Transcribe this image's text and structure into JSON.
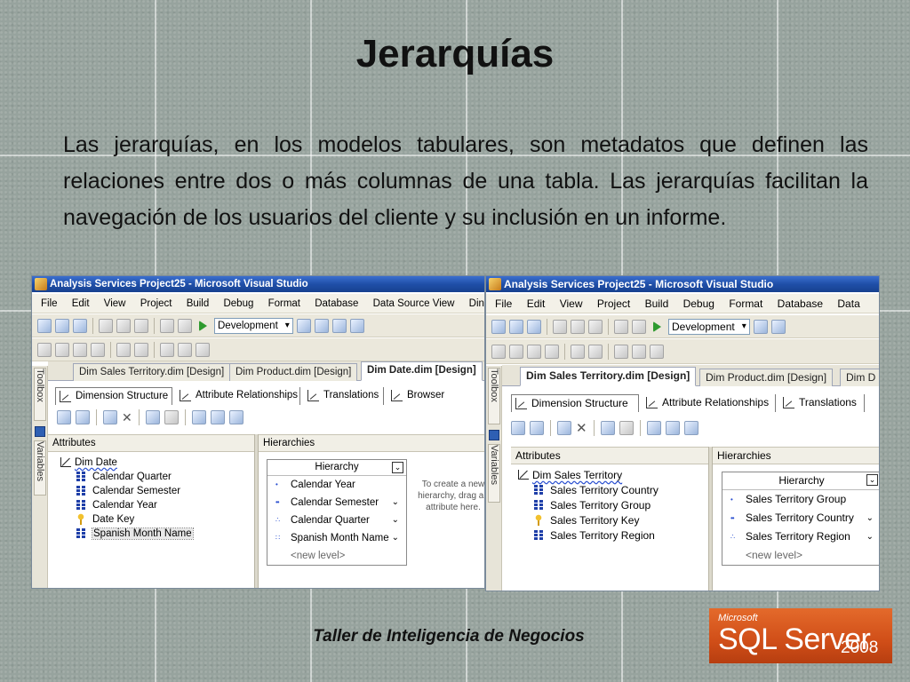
{
  "slide": {
    "title": "Jerarquías",
    "body": "Las jerarquías, en los modelos tabulares, son metadatos que definen las relaciones entre dos o más columnas de una tabla. Las jerarquías facilitan la navegación de los usuarios del cliente y su inclusión en un informe.",
    "footer": "Taller de Inteligencia de Negocios"
  },
  "logo": {
    "small": "Microsoft",
    "main": "SQL Server",
    "year": "2008"
  },
  "colors": {
    "logo_orange": "#d9561f",
    "titlebar_blue": "#1f4fa8",
    "background_gray": "#97a39e"
  },
  "screenshots": [
    {
      "window_title": "Analysis Services Project25 - Microsoft Visual Studio",
      "menu": [
        "File",
        "Edit",
        "View",
        "Project",
        "Build",
        "Debug",
        "Format",
        "Database",
        "Data Source View",
        "Din"
      ],
      "config": "Development",
      "side_labels": [
        "Toolbox",
        "Variables"
      ],
      "doc_tabs": [
        "Dim Sales Territory.dim [Design]",
        "Dim Product.dim [Design]",
        "Dim Date.dim [Design]"
      ],
      "active_doc_tab": 2,
      "sub_tabs": [
        "Dimension Structure",
        "Attribute Relationships",
        "Translations",
        "Browser"
      ],
      "attributes_header": "Attributes",
      "hierarchies_header": "Hierarchies",
      "dimension": "Dim Date",
      "attributes": [
        {
          "name": "Calendar Quarter",
          "icon": "attribute-icon"
        },
        {
          "name": "Calendar Semester",
          "icon": "attribute-icon"
        },
        {
          "name": "Calendar Year",
          "icon": "attribute-icon"
        },
        {
          "name": "Date Key",
          "icon": "key-attribute-icon"
        },
        {
          "name": "Spanish Month Name",
          "icon": "attribute-icon"
        }
      ],
      "hierarchy_title": "Hierarchy",
      "levels": [
        "Calendar Year",
        "Calendar Semester",
        "Calendar Quarter",
        "Spanish Month Name"
      ],
      "new_level": "<new level>",
      "drop_hint": "To create a new hierarchy, drag an attribute here."
    },
    {
      "window_title": "Analysis Services Project25 - Microsoft Visual Studio",
      "menu": [
        "File",
        "Edit",
        "View",
        "Project",
        "Build",
        "Debug",
        "Format",
        "Database",
        "Data"
      ],
      "config": "Development",
      "side_labels": [
        "Toolbox",
        "Variables"
      ],
      "doc_tabs": [
        "Dim Sales Territory.dim [Design]",
        "Dim Product.dim [Design]",
        "Dim D"
      ],
      "active_doc_tab": 0,
      "sub_tabs": [
        "Dimension Structure",
        "Attribute Relationships",
        "Translations"
      ],
      "attributes_header": "Attributes",
      "hierarchies_header": "Hierarchies",
      "dimension": "Dim Sales Territory",
      "attributes": [
        {
          "name": "Sales Territory Country",
          "icon": "attribute-icon"
        },
        {
          "name": "Sales Territory Group",
          "icon": "attribute-icon"
        },
        {
          "name": "Sales Territory Key",
          "icon": "key-attribute-icon"
        },
        {
          "name": "Sales Territory Region",
          "icon": "attribute-icon"
        }
      ],
      "hierarchy_title": "Hierarchy",
      "levels": [
        "Sales Territory Group",
        "Sales Territory Country",
        "Sales Territory Region"
      ],
      "new_level": "<new level>"
    }
  ]
}
